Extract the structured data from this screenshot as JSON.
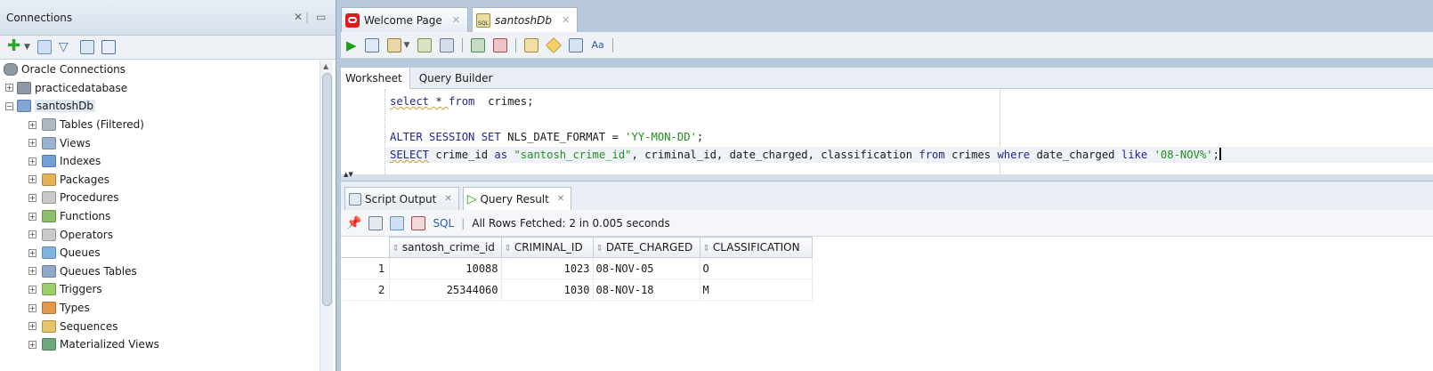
{
  "connections_panel": {
    "title": "Connections",
    "tree": [
      {
        "label": "Oracle Connections",
        "level": 0,
        "icon": "database-icon",
        "color": "#8f99a6",
        "expander": ""
      },
      {
        "label": "practicedatabase",
        "level": 1,
        "icon": "database-icon",
        "color": "#8f99a6",
        "expander": "+"
      },
      {
        "label": "santoshDb",
        "level": 1,
        "icon": "sql-connection-icon",
        "color": "#7fa6d4",
        "expander": "−",
        "selected": true
      },
      {
        "label": "Tables (Filtered)",
        "level": 2,
        "icon": "table-icon",
        "color": "#b0b8c2",
        "expander": "+"
      },
      {
        "label": "Views",
        "level": 2,
        "icon": "view-icon",
        "color": "#9ab3d1",
        "expander": "+"
      },
      {
        "label": "Indexes",
        "level": 2,
        "icon": "index-icon",
        "color": "#6fa0d8",
        "expander": "+"
      },
      {
        "label": "Packages",
        "level": 2,
        "icon": "package-icon",
        "color": "#e6b257",
        "expander": "+"
      },
      {
        "label": "Procedures",
        "level": 2,
        "icon": "procedure-icon",
        "color": "#c9c9c9",
        "expander": "+"
      },
      {
        "label": "Functions",
        "level": 2,
        "icon": "function-icon",
        "color": "#8cc06d",
        "expander": "+"
      },
      {
        "label": "Operators",
        "level": 2,
        "icon": "operator-icon",
        "color": "#c9c9c9",
        "expander": "+"
      },
      {
        "label": "Queues",
        "level": 2,
        "icon": "queue-icon",
        "color": "#7fb4e0",
        "expander": "+"
      },
      {
        "label": "Queues Tables",
        "level": 2,
        "icon": "queue-table-icon",
        "color": "#8fa9c9",
        "expander": "+"
      },
      {
        "label": "Triggers",
        "level": 2,
        "icon": "trigger-icon",
        "color": "#9bcf6a",
        "expander": "+"
      },
      {
        "label": "Types",
        "level": 2,
        "icon": "type-icon",
        "color": "#e29a4a",
        "expander": "+"
      },
      {
        "label": "Sequences",
        "level": 2,
        "icon": "sequence-icon",
        "color": "#e6c46a",
        "expander": "+"
      },
      {
        "label": "Materialized Views",
        "level": 2,
        "icon": "materialized-view-icon",
        "color": "#6fa87a",
        "expander": "+"
      }
    ]
  },
  "doc_tabs": [
    {
      "label": "Welcome Page",
      "icon": "oracle-logo-icon"
    },
    {
      "label": "santoshDb",
      "icon": "sql-worksheet-icon"
    }
  ],
  "worksheet_tabs": [
    "Worksheet",
    "Query Builder"
  ],
  "editor": {
    "line1": {
      "k1": "select",
      "rest1": " * ",
      "k2": "from",
      "rest2": "  crimes;"
    },
    "line2": {
      "k1": "ALTER SESSION SET",
      "rest1": " NLS_DATE_FORMAT = ",
      "s1": "'YY-MON-DD'",
      "rest2": ";"
    },
    "line3": {
      "k1": "SELECT",
      "r1": " crime_id ",
      "k2": "as",
      "r2": " ",
      "s1": "\"santosh_crime_id\"",
      "r3": ", criminal_id, date_charged, classification ",
      "k3": "from",
      "r4": " crimes ",
      "k4": "where",
      "r5": " date_charged ",
      "k5": "like",
      "r6": " ",
      "s2": "'08-NOV%'",
      "r7": ";"
    }
  },
  "output_tabs": [
    "Script Output",
    "Query Result"
  ],
  "result_toolbar": {
    "sql_label": "SQL",
    "status": "All Rows Fetched: 2 in 0.005 seconds"
  },
  "result_grid": {
    "columns": [
      "santosh_crime_id",
      "CRIMINAL_ID",
      "DATE_CHARGED",
      "CLASSIFICATION"
    ],
    "rows": [
      {
        "n": "1",
        "crime_id": "10088",
        "criminal_id": "1023",
        "date": "08-NOV-05",
        "class": "O"
      },
      {
        "n": "2",
        "crime_id": "25344060",
        "criminal_id": "1030",
        "date": "08-NOV-18",
        "class": "M"
      }
    ]
  },
  "colors": {
    "keyword": "#22268a",
    "string": "#1f8f1f",
    "accent": "#2a5db0"
  }
}
